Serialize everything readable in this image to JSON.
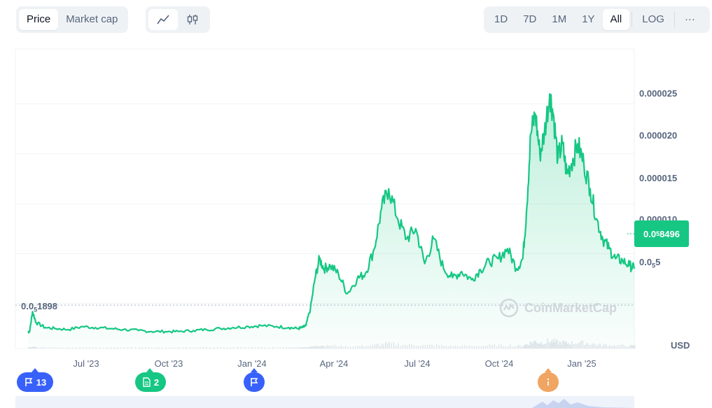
{
  "toolbar": {
    "price_label": "Price",
    "market_cap_label": "Market cap",
    "line_icon": "line-chart-icon",
    "candle_icon": "candlestick-icon",
    "ranges": [
      "1D",
      "7D",
      "1M",
      "1Y",
      "All"
    ],
    "active_range": "All",
    "log_label": "LOG",
    "more_label": "···"
  },
  "colors": {
    "line": "#16c784",
    "price_badge": "#16c784",
    "marker_blue": "#3861fb",
    "marker_green": "#16c784",
    "marker_orange": "#f0a563"
  },
  "chart_data": {
    "type": "area",
    "x_ticks": [
      "Jul '23",
      "Oct '23",
      "Jan '24",
      "Apr '24",
      "Jul '24",
      "Oct '24",
      "Jan '25"
    ],
    "y_ticks": [
      {
        "value": 5e-06,
        "main": "0.0",
        "sub": "5",
        "rest": "5"
      },
      {
        "value": 1e-05,
        "main": "0.000010"
      },
      {
        "value": 1.5e-05,
        "main": "0.000015"
      },
      {
        "value": 2e-05,
        "main": "0.000020"
      },
      {
        "value": 2.5e-05,
        "main": "0.000025"
      }
    ],
    "ylim": [
      5e-07,
      3.05e-05
    ],
    "unit": "USD",
    "current_price": {
      "value": 8.496e-06,
      "main": "0.0",
      "sub": "5",
      "rest": "8496"
    },
    "low_price": {
      "value": 1.898e-06,
      "main": "0.0",
      "sub": "5",
      "rest": "1898"
    },
    "x": [
      "2023-05-01",
      "2023-05-03",
      "2023-05-06",
      "2023-05-10",
      "2023-05-20",
      "2023-06-01",
      "2023-06-15",
      "2023-07-01",
      "2023-07-15",
      "2023-08-01",
      "2023-08-15",
      "2023-09-01",
      "2023-09-15",
      "2023-10-01",
      "2023-10-15",
      "2023-11-01",
      "2023-11-15",
      "2023-12-01",
      "2023-12-15",
      "2024-01-01",
      "2024-01-15",
      "2024-02-01",
      "2024-02-15",
      "2024-02-25",
      "2024-03-01",
      "2024-03-05",
      "2024-03-10",
      "2024-03-15",
      "2024-03-20",
      "2024-03-25",
      "2024-04-01",
      "2024-04-10",
      "2024-04-20",
      "2024-05-01",
      "2024-05-10",
      "2024-05-20",
      "2024-05-28",
      "2024-06-05",
      "2024-06-15",
      "2024-06-25",
      "2024-07-05",
      "2024-07-15",
      "2024-07-25",
      "2024-08-05",
      "2024-08-15",
      "2024-08-25",
      "2024-09-05",
      "2024-09-15",
      "2024-09-25",
      "2024-10-05",
      "2024-10-15",
      "2024-10-25",
      "2024-11-01",
      "2024-11-05",
      "2024-11-10",
      "2024-11-15",
      "2024-11-20",
      "2024-11-25",
      "2024-12-01",
      "2024-12-05",
      "2024-12-10",
      "2024-12-15",
      "2024-12-20",
      "2024-12-25",
      "2025-01-01",
      "2025-01-08",
      "2025-01-15",
      "2025-01-22",
      "2025-01-29",
      "2025-02-05",
      "2025-02-12",
      "2025-02-20",
      "2025-02-28",
      "2025-03-05"
    ],
    "values": [
      2.1e-06,
      2.3e-06,
      4.2e-06,
      3.1e-06,
      2.6e-06,
      2.5e-06,
      2.4e-06,
      2.7e-06,
      2.6e-06,
      2.5e-06,
      2.4e-06,
      2.3e-06,
      2.2e-06,
      2.2e-06,
      2.2e-06,
      2.3e-06,
      2.4e-06,
      2.5e-06,
      2.6e-06,
      2.7e-06,
      2.8e-06,
      2.7e-06,
      2.6e-06,
      2.5e-06,
      2.6e-06,
      2.8e-06,
      4.5e-06,
      7.5e-06,
      9.5e-06,
      8.5e-06,
      8.8e-06,
      8e-06,
      6e-06,
      7.5e-06,
      8e-06,
      1.05e-05,
      1.45e-05,
      1.65e-05,
      1.35e-05,
      1.15e-05,
      1.25e-05,
      9e-06,
      1.15e-05,
      8.5e-06,
      7.6e-06,
      8.2e-06,
      7.4e-06,
      8.4e-06,
      9.2e-06,
      9.5e-06,
      1.05e-05,
      8.5e-06,
      9.5e-06,
      1.4e-05,
      2.2e-05,
      2.4e-05,
      2e-05,
      2.2e-05,
      2.6e-05,
      2.4e-05,
      1.95e-05,
      2.1e-05,
      1.8e-05,
      1.9e-05,
      2.1e-05,
      1.9e-05,
      1.65e-05,
      1.35e-05,
      1.15e-05,
      1.05e-05,
      9.5e-06,
      9.3e-06,
      8.8e-06,
      8.5e-06
    ]
  },
  "watermark": "CoinMarketCap",
  "event_markers": [
    {
      "icon": "flag-icon",
      "count": "13",
      "color": "#3861fb"
    },
    {
      "icon": "document-icon",
      "count": "2",
      "color": "#16c784"
    },
    {
      "icon": "flag-icon",
      "count": "",
      "color": "#3861fb"
    },
    {
      "icon": "info-icon",
      "count": "",
      "color": "#f0a563"
    }
  ]
}
